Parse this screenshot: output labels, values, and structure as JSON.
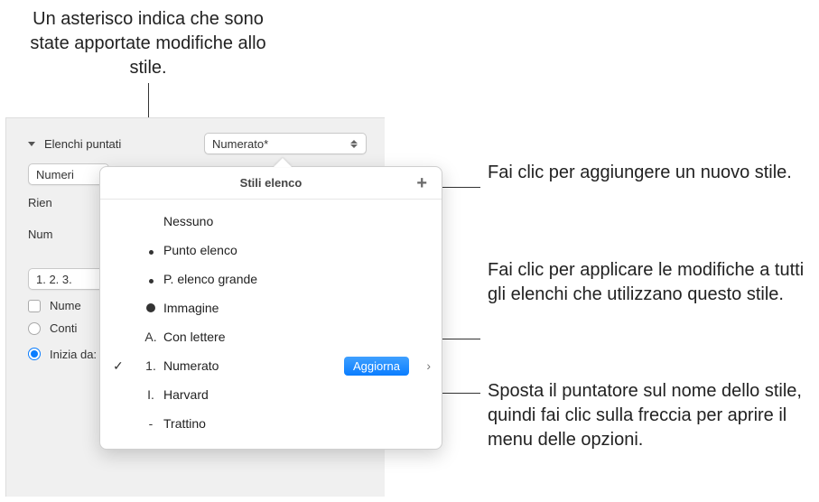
{
  "callouts": {
    "top": "Un asterisco indica che sono state apportate modifiche allo stile.",
    "add": "Fai clic per aggiungere un nuovo stile.",
    "update": "Fai clic per applicare le modifiche a tutti gli elenchi che utilizzano questo stile.",
    "arrow": "Sposta il puntatore sul nome dello stile, quindi fai clic sulla freccia per aprire il menu delle opzioni."
  },
  "panel": {
    "section_label": "Elenchi puntati",
    "style_dropdown_value": "Numerato*",
    "numeri_label": "Numeri",
    "rientro_label": "Rien",
    "numero_label": "Num",
    "format_value": "1. 2. 3.",
    "nume_checkbox_label": "Nume",
    "continue_label": "Conti",
    "start_from_label": "Inizia da:"
  },
  "popover": {
    "title": "Stili elenco",
    "plus": "+",
    "update_btn": "Aggiorna",
    "options_arrow": "›",
    "items": [
      {
        "marker": "",
        "label": "Nessuno"
      },
      {
        "marker": "dot-small",
        "label": "Punto elenco"
      },
      {
        "marker": "dot-small",
        "label": "P. elenco grande"
      },
      {
        "marker": "dot-large",
        "label": "Immagine"
      },
      {
        "marker": "A.",
        "label": "Con lettere"
      },
      {
        "marker": "1.",
        "label": "Numerato"
      },
      {
        "marker": "I.",
        "label": "Harvard"
      },
      {
        "marker": "-",
        "label": "Trattino"
      }
    ],
    "selected_index": 5
  }
}
